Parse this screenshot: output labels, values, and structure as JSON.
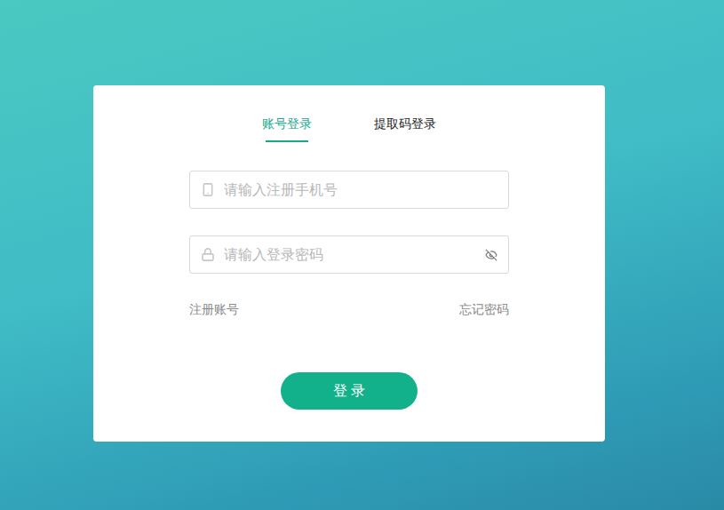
{
  "tabs": [
    {
      "label": "账号登录",
      "selected": true
    },
    {
      "label": "提取码登录",
      "selected": false
    }
  ],
  "fields": [
    {
      "kind": "phone",
      "placeholder": "请输入注册手机号",
      "value": ""
    },
    {
      "kind": "password",
      "placeholder": "请输入登录密码",
      "value": "",
      "password_visible": false
    }
  ],
  "links": {
    "register": "注册账号",
    "forgot": "忘记密码"
  },
  "button": {
    "label": "登 录"
  }
}
